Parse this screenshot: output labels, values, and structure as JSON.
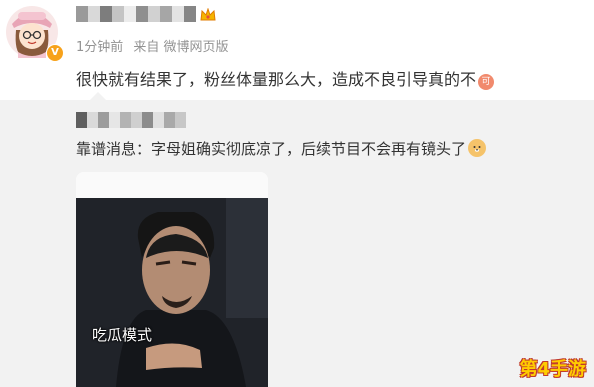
{
  "post": {
    "meta": {
      "time": "1分钟前",
      "source": "来自 微博网页版"
    },
    "text": "很快就有结果了，粉丝体量那么大，造成不良引导真的不",
    "emoji_label": "可"
  },
  "repost": {
    "text_source": "靠谱消息",
    "text_body": "：字母姐确实彻底凉了，后续节目不会再有镜头了",
    "media": {
      "caption": "吃瓜模式"
    }
  },
  "watermark": "第4手游",
  "colors": {
    "repost_background": "#f2f2f2",
    "meta_gray": "#939393",
    "verified_badge": "#f7a21b"
  },
  "icons": [
    "avatar-cartoon-girl",
    "verified-v-icon",
    "crown-icon",
    "ke-emoji-icon",
    "doge-emoji-icon"
  ]
}
